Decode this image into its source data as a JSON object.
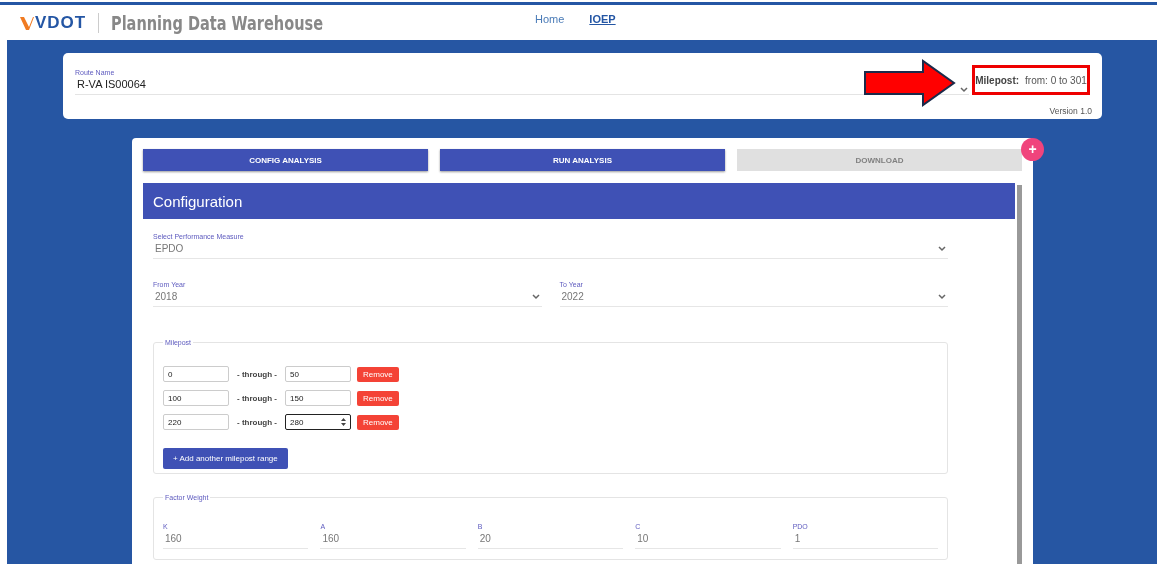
{
  "header": {
    "logo": "VDOT",
    "title": "Planning Data Warehouse",
    "nav": [
      {
        "label": "Home",
        "selected": false
      },
      {
        "label": "IOEP",
        "selected": true
      }
    ]
  },
  "route": {
    "label": "Route Name",
    "value": "R-VA IS00064",
    "milepost_label": "Milepost:",
    "milepost_value": "from: 0 to 301",
    "version": "Version 1.0"
  },
  "actions": [
    {
      "label": "CONFIG ANALYSIS",
      "disabled": false
    },
    {
      "label": "RUN ANALYSIS",
      "disabled": false
    },
    {
      "label": "DOWNLOAD",
      "disabled": true
    }
  ],
  "fab": "+",
  "configuration": {
    "title": "Configuration",
    "measure": {
      "label": "Select Performance Measure",
      "value": "EPDO"
    },
    "from_year": {
      "label": "From Year",
      "value": "2018"
    },
    "to_year": {
      "label": "To Year",
      "value": "2022"
    },
    "milepost": {
      "legend": "Milepost",
      "ranges": [
        {
          "from": "0",
          "separator": "- through -",
          "to": "50",
          "focused": false,
          "remove": "Remove"
        },
        {
          "from": "100",
          "separator": "- through -",
          "to": "150",
          "focused": false,
          "remove": "Remove"
        },
        {
          "from": "220",
          "separator": "- through -",
          "to": "280",
          "focused": true,
          "remove": "Remove"
        }
      ],
      "add": "+ Add another milepost range"
    },
    "factor_weight": {
      "legend": "Factor Weight",
      "fields": [
        {
          "label": "K",
          "value": "160"
        },
        {
          "label": "A",
          "value": "160"
        },
        {
          "label": "B",
          "value": "20"
        },
        {
          "label": "C",
          "value": "10"
        },
        {
          "label": "PDO",
          "value": "1"
        }
      ]
    }
  }
}
